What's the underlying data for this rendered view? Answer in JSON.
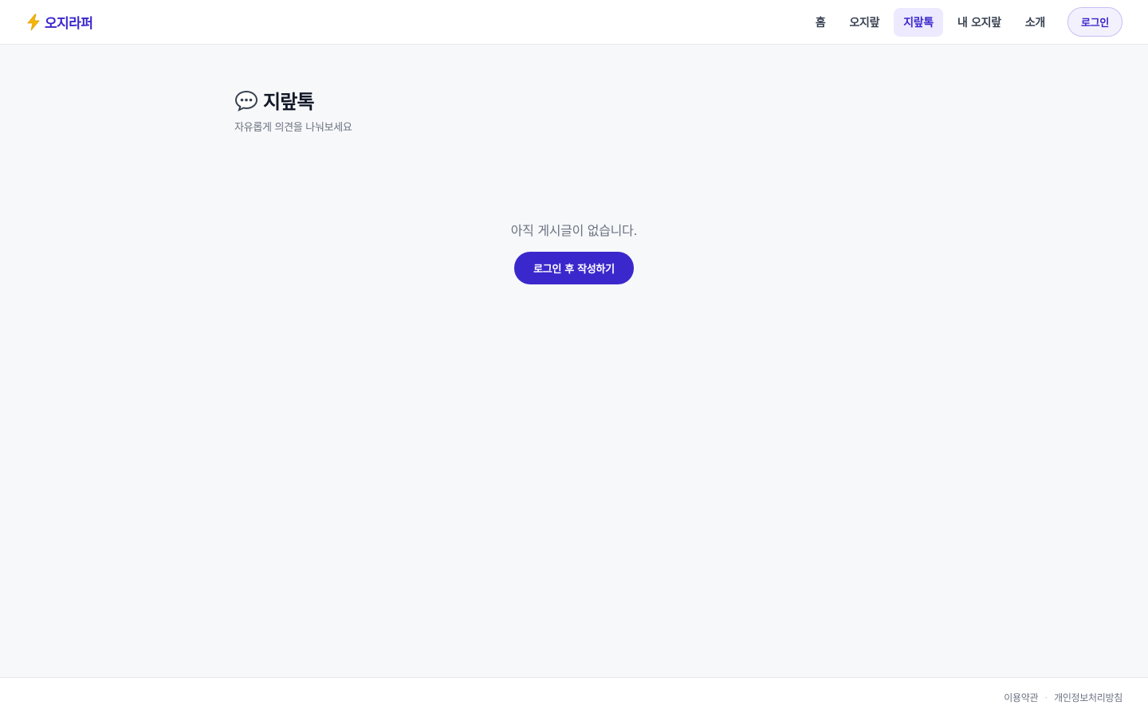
{
  "header": {
    "logo_icon": "lightning-icon",
    "logo_text": "오지라퍼",
    "brand_color": "#3b28cc",
    "nav": [
      {
        "label": "홈",
        "active": false
      },
      {
        "label": "오지랖",
        "active": false
      },
      {
        "label": "지랖톡",
        "active": true
      },
      {
        "label": "내 오지랖",
        "active": false
      },
      {
        "label": "소개",
        "active": false
      }
    ],
    "login_label": "로그인"
  },
  "main": {
    "title_icon": "speech-bubble-icon",
    "title": "지랖톡",
    "subtitle": "자유롭게 의견을 나눠보세요",
    "empty_text": "아직 게시글이 없습니다.",
    "write_button_label": "로그인 후 작성하기"
  },
  "footer": {
    "links": [
      "이용약관",
      "개인정보처리방침"
    ],
    "separator": "·"
  }
}
